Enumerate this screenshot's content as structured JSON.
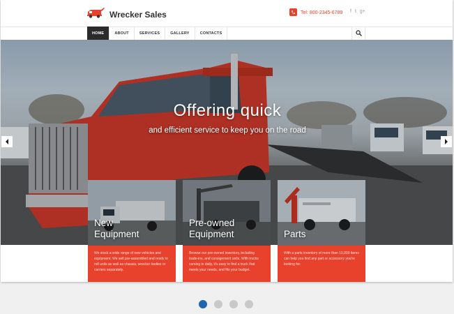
{
  "brand": {
    "name": "Wrecker Sales",
    "accent": "#e8412c"
  },
  "header": {
    "phone": "Tel: 800-2345-6789",
    "socials": [
      "f",
      "t",
      "g+"
    ]
  },
  "nav": {
    "items": [
      {
        "label": "Home",
        "active": true
      },
      {
        "label": "About"
      },
      {
        "label": "Services"
      },
      {
        "label": "Gallery"
      },
      {
        "label": "Contacts"
      }
    ]
  },
  "hero": {
    "title": "Offering quick",
    "subtitle": "and efficient service to keep you on the road"
  },
  "cards": [
    {
      "title": "New Equipment",
      "title_line1": "New",
      "title_line2": "Equipment",
      "text": "We stock a wide range of new vehicles and equipment. We sell pre-assembled and ready to roll units as well as chassis, wrecker bodies or carriers separately."
    },
    {
      "title": "Pre-owned Equipment",
      "title_line1": "Pre-owned",
      "title_line2": "Equipment",
      "text": "Browse our pre-owned inventory, including trade-ins, and consignment units. With trucks coming in daily, it's easy to find a truck that meets your needs, and fits your budget."
    },
    {
      "title": "Parts",
      "title_line1": "Parts",
      "title_line2": "",
      "text": "With a parts inventory of more than 10,000 items can help you find any part or accessory you're looking for."
    }
  ],
  "slider": {
    "dots": 4,
    "active": 1
  }
}
